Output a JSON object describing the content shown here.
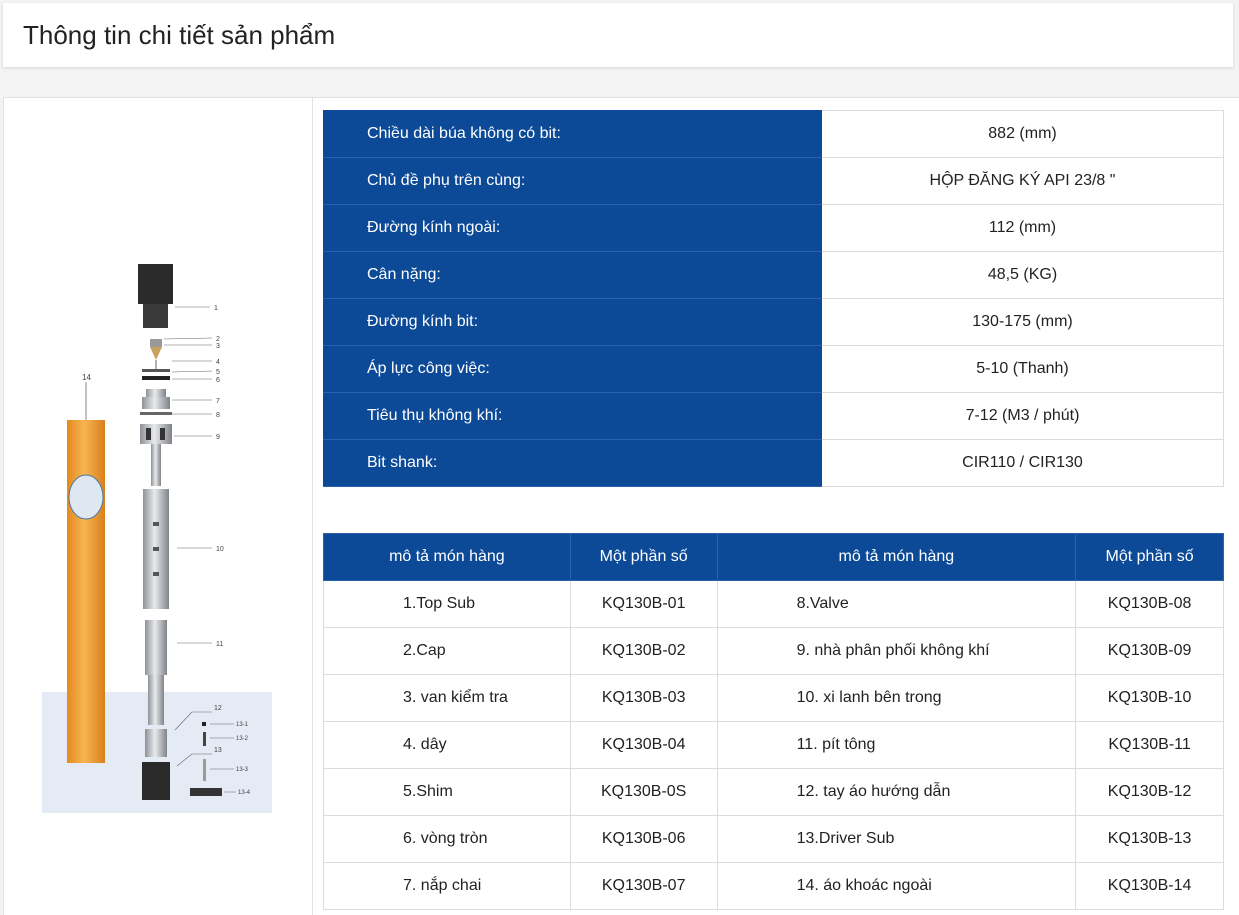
{
  "page_title": "Thông tin chi tiết sản phẩm",
  "specs": [
    {
      "label": "Chiều dài búa không có bit:",
      "value": "882 (mm)"
    },
    {
      "label": "Chủ đề phụ trên cùng:",
      "value": "HỘP ĐĂNG KÝ API 23/8 \""
    },
    {
      "label": "Đường kính ngoài:",
      "value": "112 (mm)"
    },
    {
      "label": "Cân nặng:",
      "value": "48,5 (KG)"
    },
    {
      "label": "Đường kính bit:",
      "value": "130-175 (mm)"
    },
    {
      "label": "Áp lực công việc:",
      "value": "5-10 (Thanh)"
    },
    {
      "label": "Tiêu thụ không khí:",
      "value": "7-12 (M3 / phút)"
    },
    {
      "label": "Bit shank:",
      "value": "CIR110 / CIR130"
    }
  ],
  "parts_table": {
    "headers": [
      "mô tả món hàng",
      "Một phần số",
      "mô tả món hàng",
      "Một phần số"
    ],
    "rows": [
      [
        "1.Top Sub",
        "KQ130B-01",
        "8.Valve",
        "KQ130B-08"
      ],
      [
        "2.Cap",
        "KQ130B-02",
        "9. nhà phân phối không khí",
        "KQ130B-09"
      ],
      [
        "3. van kiểm tra",
        "KQ130B-03",
        "10. xi lanh bên trong",
        "KQ130B-10"
      ],
      [
        "4. dây",
        "KQ130B-04",
        "11. pít tông",
        "KQ130B-11"
      ],
      [
        "5.Shim",
        "KQ130B-0S",
        "12. tay áo hướng dẫn",
        "KQ130B-12"
      ],
      [
        "6. vòng tròn",
        "KQ130B-06",
        "13.Driver Sub",
        "KQ130B-13"
      ],
      [
        "7. nắp chai",
        "KQ130B-07",
        "14. áo khoác ngoài",
        "KQ130B-14"
      ]
    ]
  },
  "figure": {
    "labels": [
      "1",
      "2",
      "3",
      "4",
      "5",
      "6",
      "7",
      "8",
      "9",
      "10",
      "11",
      "12",
      "13",
      "14",
      "13-1",
      "13-2",
      "13-3",
      "13-4"
    ],
    "colors": {
      "sleeve": "#f2a23a",
      "steel": "#b9bcbf",
      "dark": "#2a2a2a"
    }
  }
}
